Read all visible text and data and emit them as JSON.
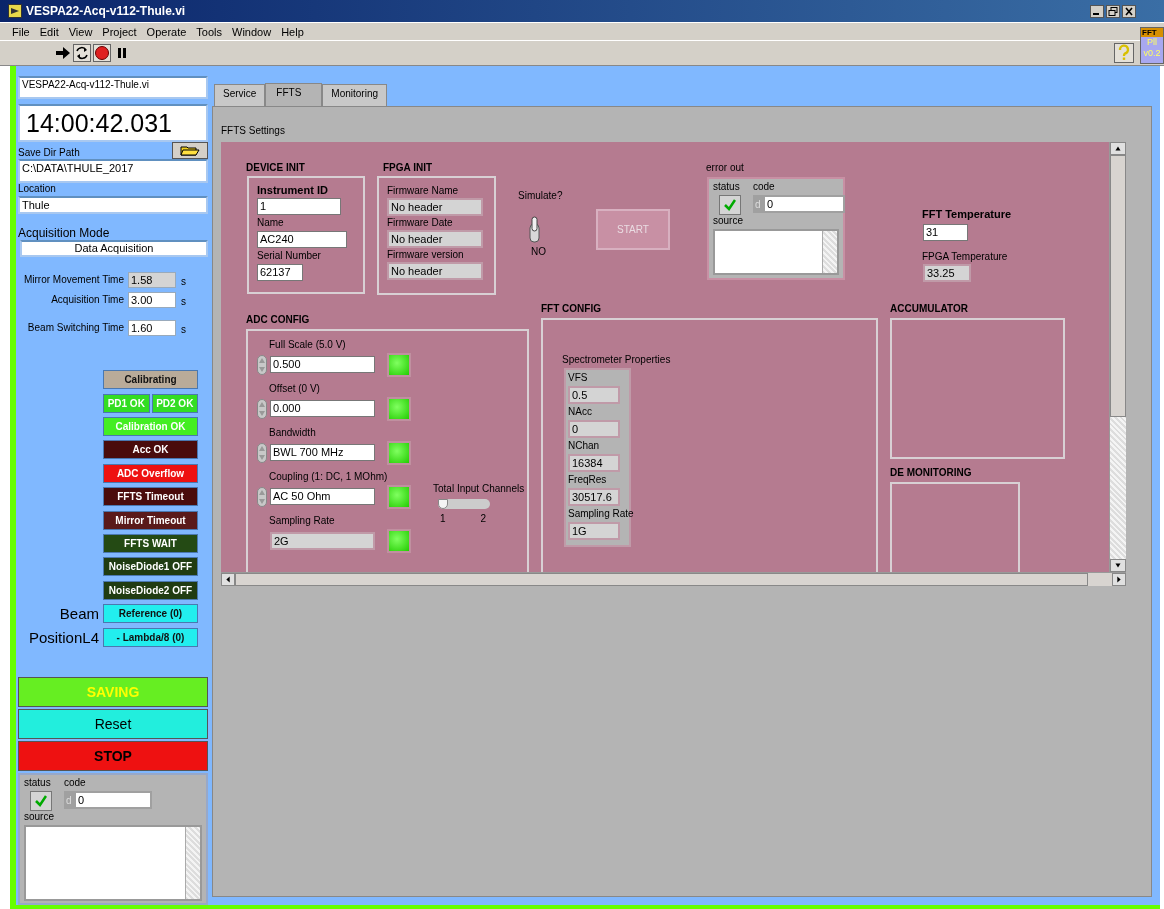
{
  "window": {
    "title": "VESPA22-Acq-v112-Thule.vi"
  },
  "menu": [
    "File",
    "Edit",
    "View",
    "Project",
    "Operate",
    "Tools",
    "Window",
    "Help"
  ],
  "plugin_badge": [
    "FFT",
    "Pll",
    "v0.2"
  ],
  "left_panel": {
    "vi_name": "VESPA22-Acq-v112-Thule.vi",
    "clock": "14:00:42.031",
    "save_dir": {
      "label": "Save Dir Path",
      "value": "C:\\DATA\\THULE_2017"
    },
    "location": {
      "label": "Location",
      "value": "Thule"
    },
    "acquisition_mode": {
      "label": "Acquisition Mode",
      "value": "Data Acquisition"
    },
    "timings": [
      {
        "label": "Mirror Movement Time",
        "value": "1.58",
        "unit": "s",
        "disabled": true
      },
      {
        "label": "Acquisition Time",
        "value": "3.00",
        "unit": "s",
        "disabled": false
      },
      {
        "label": "Beam Switching Time",
        "value": "1.60",
        "unit": "s",
        "disabled": false
      }
    ],
    "indicator_rows": [
      {
        "items": [
          {
            "label": "Calibrating",
            "color": "#b9ab99"
          }
        ]
      },
      {
        "items": [
          {
            "label": "PD1 OK",
            "color": "#33dd22"
          },
          {
            "label": "PD2 OK",
            "color": "#33dd22"
          }
        ]
      },
      {
        "items": [
          {
            "label": "Calibration OK",
            "color": "#44ee22"
          }
        ]
      },
      {
        "items": [
          {
            "label": "Acc OK",
            "color": "#4a0c0c"
          }
        ]
      },
      {
        "items": [
          {
            "label": "ADC Overflow",
            "color": "#ee1111"
          }
        ]
      },
      {
        "items": [
          {
            "label": "FFTS Timeout",
            "color": "#4a0c0c"
          }
        ]
      },
      {
        "items": [
          {
            "label": "Mirror Timeout",
            "color": "#5a1a1a"
          }
        ]
      },
      {
        "items": [
          {
            "label": "FFTS WAIT",
            "color": "#244a14"
          }
        ]
      },
      {
        "items": [
          {
            "label": "NoiseDiode1 OFF",
            "color": "#203c12"
          }
        ]
      },
      {
        "items": [
          {
            "label": "NoiseDiode2 OFF",
            "color": "#203c12"
          }
        ]
      },
      {
        "label": "Beam",
        "items": [
          {
            "label": "Reference (0)",
            "color": "#22eeee"
          }
        ]
      },
      {
        "label": "PositionL4",
        "items": [
          {
            "label": "- Lambda/8 (0)",
            "color": "#22eeee"
          }
        ]
      }
    ],
    "buttons": [
      {
        "label": "SAVING",
        "color": "#66ee22",
        "kind": "status"
      },
      {
        "label": "Reset",
        "color": "#22eedd",
        "kind": "action"
      },
      {
        "label": "STOP",
        "color": "#ee1111",
        "kind": "action"
      }
    ],
    "error": {
      "status_label": "status",
      "status_ok": true,
      "code_label": "code",
      "radix": "d",
      "code": "0",
      "source_label": "source"
    }
  },
  "tabs": [
    {
      "label": "Service",
      "selected": false
    },
    {
      "label": "FFTS",
      "selected": true
    },
    {
      "label": "Monitoring",
      "selected": false
    }
  ],
  "page": {
    "title": "FFTS Settings",
    "device_init": {
      "title": "DEVICE INIT",
      "fields": [
        {
          "label": "Instrument ID",
          "value": "1"
        },
        {
          "label": "Name",
          "value": "AC240"
        },
        {
          "label": "Serial Number",
          "value": "62137"
        }
      ]
    },
    "fpga_init": {
      "title": "FPGA INIT",
      "fields": [
        {
          "label": "Firmware Name",
          "value": "No header"
        },
        {
          "label": "Firmware Date",
          "value": "No header"
        },
        {
          "label": "Firmware version",
          "value": "No header"
        }
      ]
    },
    "simulate": {
      "label": "Simulate?",
      "on": false,
      "state": "NO"
    },
    "start": {
      "label": "START",
      "disabled": true
    },
    "error_out": {
      "label": "error out",
      "status_label": "status",
      "status_ok": true,
      "code_label": "code",
      "radix": "d",
      "code": "0",
      "source_label": "source"
    },
    "fft_temperature": {
      "label": "FFT Temperature",
      "value": "31"
    },
    "fpga_temperature": {
      "label": "FPGA Temperature",
      "value": "33.25"
    },
    "adc_config": {
      "title": "ADC CONFIG",
      "fields": [
        {
          "label": "Full Scale (5.0 V)",
          "value": "0.500",
          "kind": "spin",
          "led": true
        },
        {
          "label": "Offset (0 V)",
          "value": "0.000",
          "kind": "spin",
          "led": true
        },
        {
          "label": "Bandwidth",
          "value": "BWL 700 MHz",
          "kind": "spin",
          "led": true
        },
        {
          "label": "Coupling (1: DC, 1 MOhm)",
          "value": "AC 50 Ohm",
          "kind": "spin",
          "led": true
        },
        {
          "label": "Sampling Rate",
          "value": "2G",
          "kind": "indicator",
          "led": true
        }
      ],
      "channels_slider": {
        "label": "Total Input Channels",
        "level": 0,
        "ticks": [
          "1",
          "2"
        ]
      }
    },
    "fft_config": {
      "title": "FFT CONFIG",
      "properties_label": "Spectrometer Properties",
      "properties": [
        {
          "label": "VFS",
          "value": "0.5"
        },
        {
          "label": "NAcc",
          "value": "0"
        },
        {
          "label": "NChan",
          "value": "16384"
        },
        {
          "label": "FreqRes",
          "value": "30517.6"
        },
        {
          "label": "Sampling Rate",
          "value": "1G"
        }
      ]
    },
    "accumulator": {
      "title": "ACCUMULATOR"
    },
    "de_monitoring": {
      "title": "DE MONITORING"
    }
  }
}
